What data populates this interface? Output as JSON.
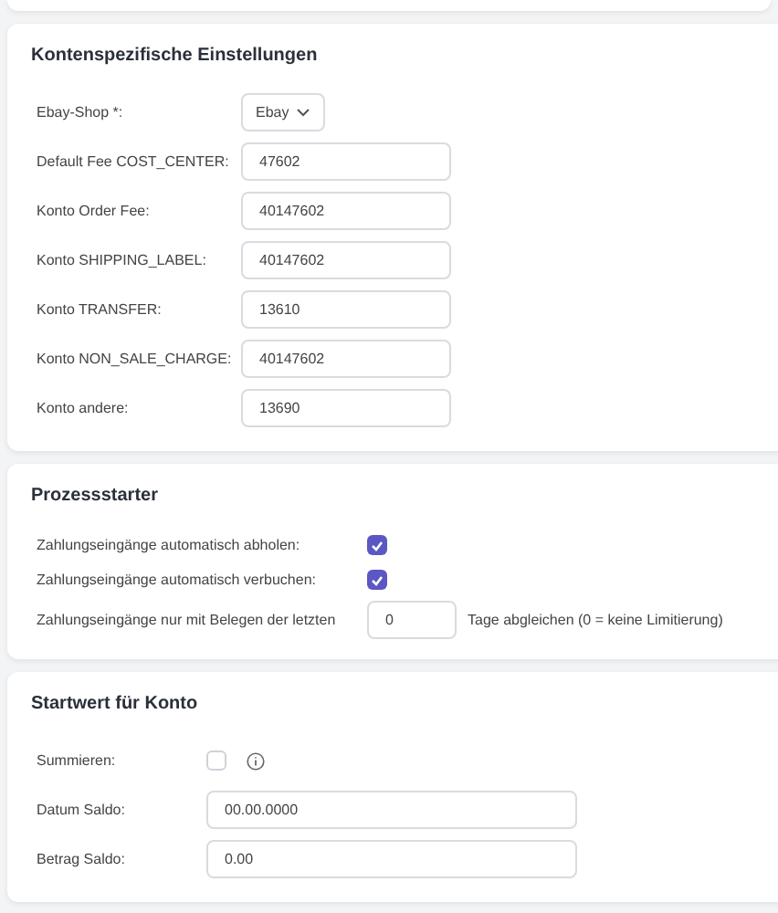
{
  "sections": [
    {
      "title": "Kontenspezifische Einstellungen",
      "rows": [
        {
          "kind": "select",
          "label": "Ebay-Shop *:",
          "value": "Ebay"
        },
        {
          "kind": "input",
          "label": "Default Fee COST_CENTER:",
          "value": "47602"
        },
        {
          "kind": "input",
          "label": "Konto Order Fee:",
          "value": "40147602"
        },
        {
          "kind": "input",
          "label": "Konto SHIPPING_LABEL:",
          "value": "40147602"
        },
        {
          "kind": "input",
          "label": "Konto TRANSFER:",
          "value": "13610"
        },
        {
          "kind": "input",
          "label": "Konto NON_SALE_CHARGE:",
          "value": "40147602"
        },
        {
          "kind": "input",
          "label": "Konto andere:",
          "value": "13690"
        }
      ]
    },
    {
      "title": "Prozessstarter",
      "rows": [
        {
          "kind": "checkbox",
          "label": "Zahlungseingänge automatisch abholen:",
          "checked": true
        },
        {
          "kind": "checkbox",
          "label": "Zahlungseingänge automatisch verbuchen:",
          "checked": true
        },
        {
          "kind": "short_input",
          "label": "Zahlungseingänge nur mit Belegen der letzten",
          "value": "0",
          "suffix": "Tage abgleichen (0 = keine Limitierung)"
        }
      ]
    },
    {
      "title": "Startwert für Konto",
      "rows": [
        {
          "kind": "checkbox_info",
          "label": "Summieren:",
          "checked": false
        },
        {
          "kind": "wide_input",
          "label": "Datum Saldo:",
          "value": "00.00.0000"
        },
        {
          "kind": "wide_input",
          "label": "Betrag Saldo:",
          "value": "0.00"
        }
      ]
    }
  ]
}
